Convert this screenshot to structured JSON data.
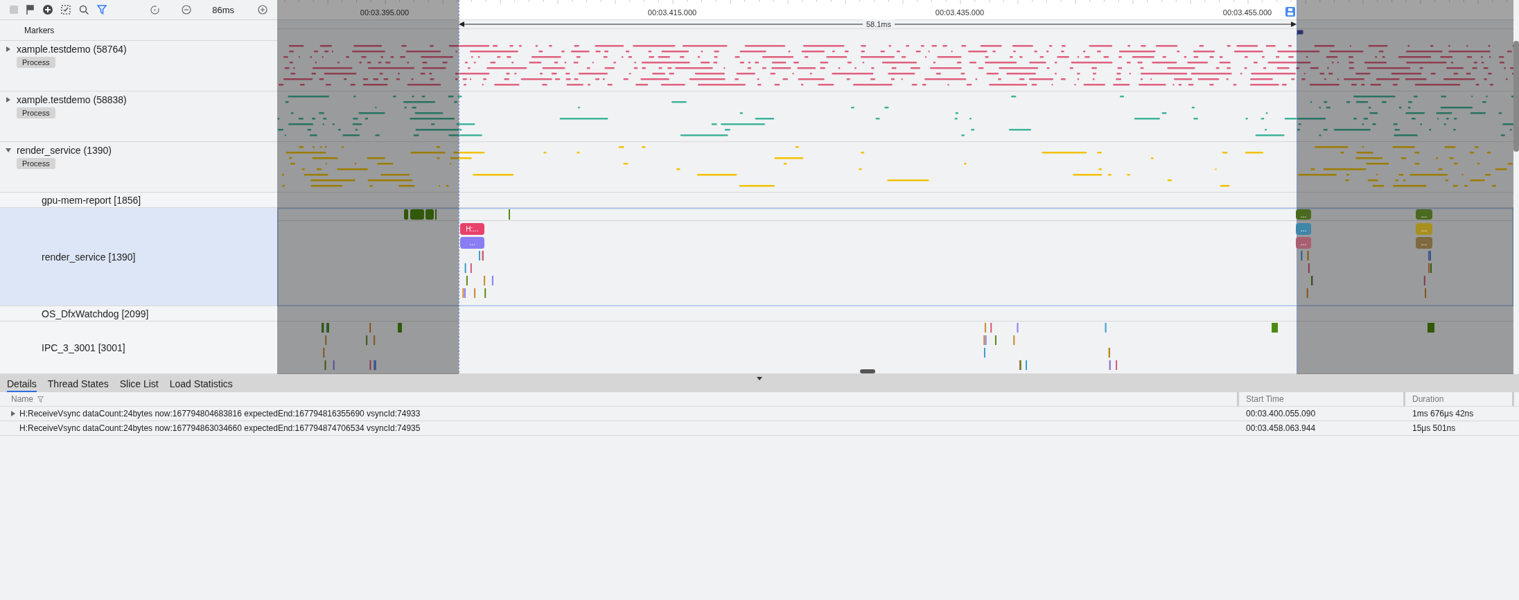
{
  "toolbar": {
    "zoom_label": "86ms",
    "filter_active": true
  },
  "markers_label": "Markers",
  "ruler": {
    "ticks": [
      "00:03.395.000",
      "00:03.415.000",
      "00:03.435.000",
      "00:03.455.000"
    ],
    "selection_label": "58.1ms"
  },
  "tracks": [
    {
      "kind": "process",
      "name": "xample.testdemo (58764)",
      "badge": "Process",
      "expanded": false,
      "selected": false,
      "color": "#e0607e"
    },
    {
      "kind": "process",
      "name": "xample.testdemo (58838)",
      "badge": "Process",
      "expanded": false,
      "selected": false,
      "color": "#3fb39a"
    },
    {
      "kind": "process",
      "name": "render_service (1390)",
      "badge": "Process",
      "expanded": true,
      "selected": false,
      "color": "#f2c200"
    },
    {
      "kind": "thread",
      "name": "gpu-mem-report [1856]",
      "selected": false
    },
    {
      "kind": "thread",
      "name": "render_service [1390]",
      "selected": true,
      "stacks": [
        {
          "slices": [
            {
              "label": "H:...",
              "color": "#e8416a",
              "children": [
                {
                  "label": "...",
                  "color": "#8a7cf3"
                }
              ]
            }
          ]
        },
        {
          "slices": [
            {
              "label": "...",
              "color": "#4a6a20",
              "children": [
                {
                  "label": "...",
                  "color": "#3f86a8",
                  "children": [
                    {
                      "label": "...",
                      "color": "#a86070"
                    }
                  ]
                }
              ]
            }
          ]
        },
        {
          "slices": [
            {
              "label": "...",
              "color": "#4a6a20",
              "children": [
                {
                  "label": "...",
                  "color": "#a89020",
                  "children": [
                    {
                      "label": "...",
                      "color": "#7f6a40"
                    }
                  ]
                }
              ]
            }
          ]
        }
      ]
    },
    {
      "kind": "thread",
      "name": "OS_DfxWatchdog [2099]",
      "selected": false
    },
    {
      "kind": "thread",
      "name": "IPC_3_3001 [3001]",
      "selected": false
    }
  ],
  "bottom_tabs": [
    {
      "label": "Details",
      "selected": true
    },
    {
      "label": "Thread States",
      "selected": false
    },
    {
      "label": "Slice List",
      "selected": false
    },
    {
      "label": "Load Statistics",
      "selected": false
    }
  ],
  "table": {
    "columns": [
      "Name",
      "Start Time",
      "Duration"
    ],
    "rows": [
      {
        "name": "H:ReceiveVsync dataCount:24bytes now:167794804683816 expectedEnd:167794816355690 vsyncId:74933",
        "start_time": "00:03.400.055.090",
        "duration": "1ms 676μs 42ns",
        "expandable": true
      },
      {
        "name": "H:ReceiveVsync dataCount:24bytes now:167794863034660 expectedEnd:167794874706534 vsyncId:74935",
        "start_time": "00:03.458.063.944",
        "duration": "15μs 501ns",
        "expandable": false
      }
    ]
  }
}
